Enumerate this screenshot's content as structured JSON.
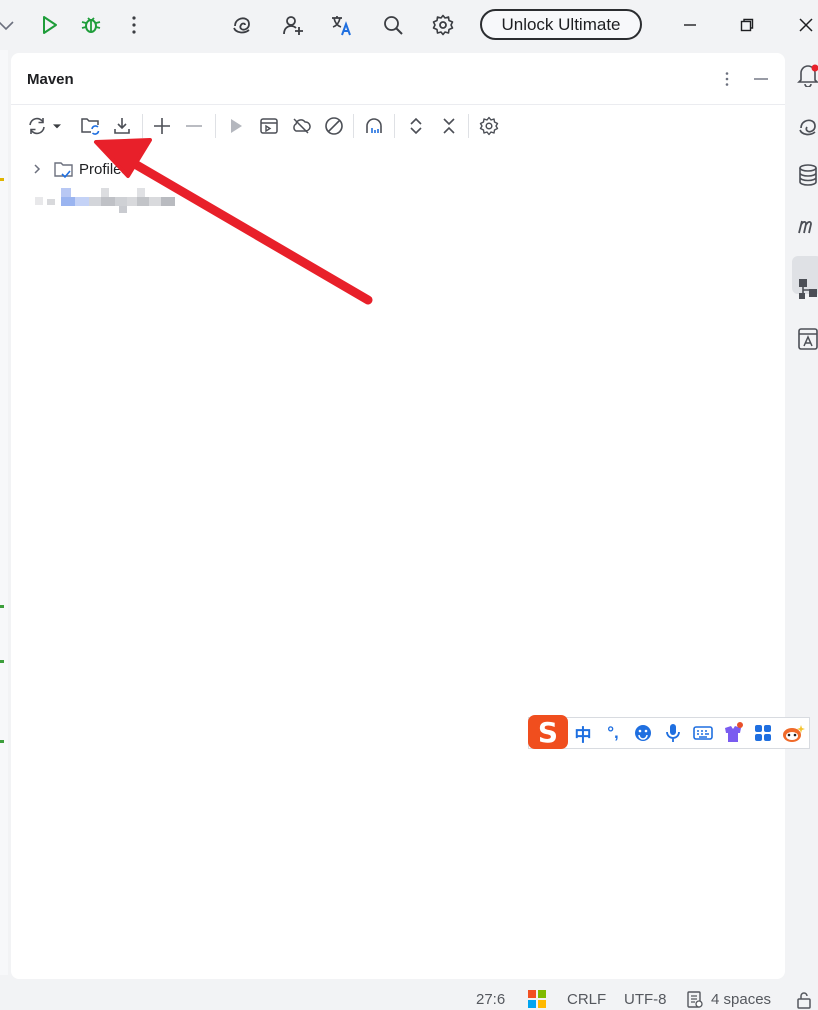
{
  "toolbar": {
    "unlock_label": "Unlock Ultimate",
    "icons": [
      "chevron-down-icon",
      "run-icon",
      "debug-icon",
      "more-icon",
      "ai-assistant-icon",
      "add-user-icon",
      "translate-icon",
      "search-icon",
      "settings-icon"
    ],
    "colors": {
      "run": "#1f9d3a",
      "debug": "#1f9d3a"
    }
  },
  "window_controls": [
    "minimize-icon",
    "restore-icon",
    "close-icon"
  ],
  "panel": {
    "title": "Maven",
    "tools": [
      "reload-icon",
      "dropdown-icon",
      "generate-sources-icon",
      "download-icon",
      "add-icon",
      "remove-icon",
      "run-icon",
      "execute-goal-icon",
      "offline-icon",
      "skip-tests-icon",
      "analyze-dependencies-icon",
      "expand-all-icon",
      "collapse-all-icon",
      "settings-icon"
    ],
    "tree": [
      {
        "label": "Profiles",
        "icon": "folder-icon"
      }
    ]
  },
  "annotation": {
    "color": "#e8202a"
  },
  "right_strip": [
    "notifications-icon",
    "ai-chat-icon",
    "database-icon",
    "maven-icon",
    "structure-icon",
    "preview-icon"
  ],
  "ime": {
    "logo": "S",
    "items": [
      "中",
      "°,",
      "☻",
      "mic-icon",
      "keyboard-icon",
      "skin-icon",
      "apps-icon",
      "mascot-icon"
    ]
  },
  "statusbar": {
    "position": "27:6",
    "line_ending": "CRLF",
    "encoding": "UTF-8",
    "indent": "4 spaces"
  }
}
